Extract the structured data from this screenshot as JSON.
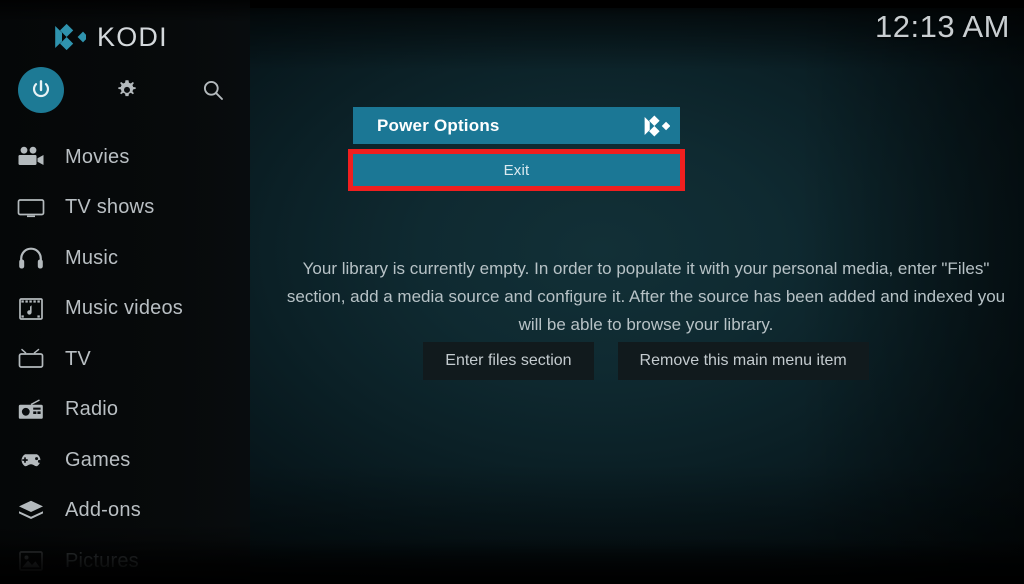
{
  "app": {
    "brand_name": "KODI",
    "brand_logo_icon": "kodi-logo-icon",
    "clock": "12:13 AM"
  },
  "sidebar": {
    "top_actions": [
      {
        "name": "power-button",
        "icon": "power-icon",
        "selected": true
      },
      {
        "name": "settings-button",
        "icon": "gear-icon",
        "selected": false
      },
      {
        "name": "search-button",
        "icon": "search-icon",
        "selected": false
      }
    ],
    "items": [
      {
        "label": "Movies",
        "icon": "movie-camera-icon",
        "dim": false
      },
      {
        "label": "TV shows",
        "icon": "monitor-icon",
        "dim": false
      },
      {
        "label": "Music",
        "icon": "headphones-icon",
        "dim": false
      },
      {
        "label": "Music videos",
        "icon": "music-video-icon",
        "dim": false
      },
      {
        "label": "TV",
        "icon": "tv-antenna-icon",
        "dim": false
      },
      {
        "label": "Radio",
        "icon": "radio-icon",
        "dim": false
      },
      {
        "label": "Games",
        "icon": "gamepad-icon",
        "dim": false
      },
      {
        "label": "Add-ons",
        "icon": "addons-box-icon",
        "dim": false
      },
      {
        "label": "Pictures",
        "icon": "pictures-icon",
        "dim": true
      }
    ]
  },
  "dialog": {
    "title": "Power Options",
    "logo_icon": "kodi-logo-icon",
    "options": [
      {
        "label": "Exit",
        "focused": true
      }
    ],
    "highlight_color": "#f01f1f"
  },
  "main": {
    "empty_message": "Your library is currently empty. In order to populate it with your personal media, enter \"Files\" section, add a media source and configure it. After the source has been added and indexed you will be able to browse your library.",
    "buttons": [
      {
        "label": "Enter files section"
      },
      {
        "label": "Remove this main menu item"
      }
    ]
  },
  "theme": {
    "accent_teal": "#1b7795",
    "power_btn_teal": "#1d7a95",
    "brand_logo_teal": "#2f93ae",
    "text_primary": "#b9bfc3",
    "background_teal": "#123037"
  }
}
